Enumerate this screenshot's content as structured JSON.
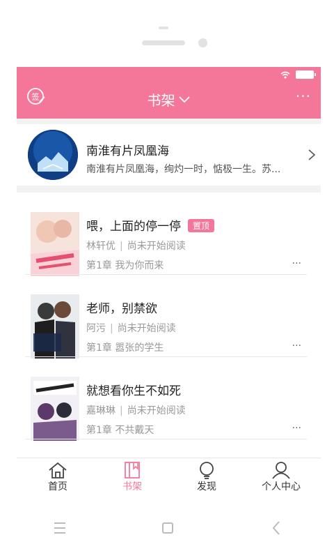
{
  "header": {
    "title": "书架",
    "colors": {
      "accent": "#f4779a"
    }
  },
  "featured": {
    "title": "南淮有片凤凰海",
    "description": "南淮有片凤凰海，绚灼一时，惦极一生。苏..."
  },
  "books": [
    {
      "title": "喂，上面的停一停",
      "badge": "置顶",
      "author": "林轩优",
      "status": "尚未开始阅读",
      "chapter": "第1章 我为你而来"
    },
    {
      "title": "老师，别禁欲",
      "badge": "",
      "author": "阿污",
      "status": "尚未开始阅读",
      "chapter": "第1章 嚣张的学生"
    },
    {
      "title": "就想看你生不如死",
      "badge": "",
      "author": "嘉琳琳",
      "status": "尚未开始阅读",
      "chapter": "第1章 不共戴天"
    }
  ],
  "tabs": [
    {
      "label": "首页",
      "icon": "home-icon"
    },
    {
      "label": "书架",
      "icon": "bookshelf-icon"
    },
    {
      "label": "发现",
      "icon": "lightbulb-icon"
    },
    {
      "label": "个人中心",
      "icon": "user-icon"
    }
  ],
  "ui": {
    "more_symbol": "···",
    "author_separator": "|"
  }
}
